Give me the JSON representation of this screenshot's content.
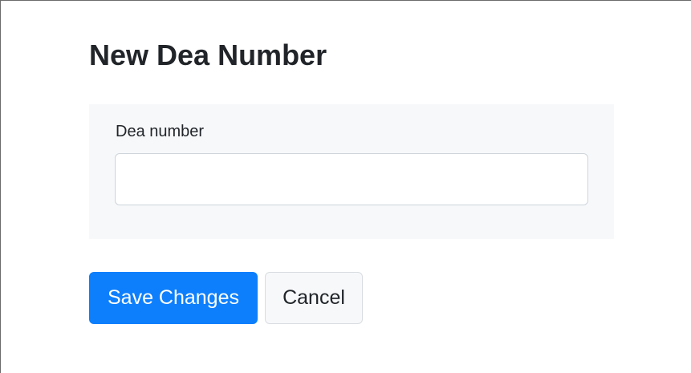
{
  "page": {
    "title": "New Dea Number"
  },
  "form": {
    "field_label": "Dea number",
    "field_value": "",
    "field_placeholder": ""
  },
  "actions": {
    "save_label": "Save Changes",
    "cancel_label": "Cancel"
  },
  "colors": {
    "primary": "#0d7ffc",
    "card_background": "#f7f8fa",
    "text": "#212529"
  }
}
